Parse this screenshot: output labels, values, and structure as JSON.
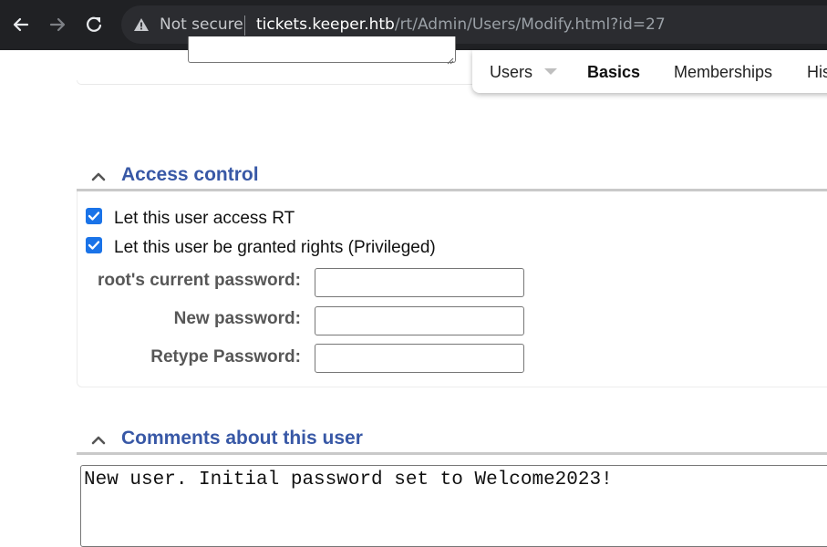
{
  "browser": {
    "security_label": "Not secure",
    "url_host": "tickets.keeper.htb",
    "url_path": "/rt/Admin/Users/Modify.html?id=27"
  },
  "tabs": {
    "users": "Users",
    "basics": "Basics",
    "memberships": "Memberships",
    "history": "His"
  },
  "access_control": {
    "title": "Access control",
    "let_access": {
      "label": "Let this user access RT",
      "checked": true
    },
    "privileged": {
      "label": "Let this user be granted rights (Privileged)",
      "checked": true
    },
    "current_password_label": "root's current password:",
    "new_password_label": "New password:",
    "retype_password_label": "Retype Password:"
  },
  "comments": {
    "title": "Comments about this user",
    "text": "New user. Initial password set to Welcome2023!"
  },
  "colors": {
    "section_title": "#3858a6",
    "checkbox": "#1a73e8",
    "chrome_bg": "#202124"
  }
}
